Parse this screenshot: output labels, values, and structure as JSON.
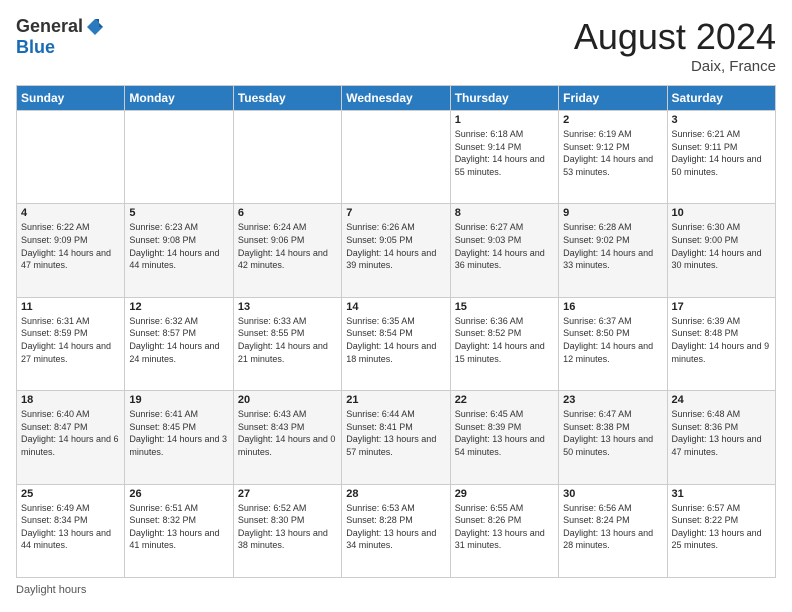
{
  "header": {
    "logo_general": "General",
    "logo_blue": "Blue",
    "month_year": "August 2024",
    "location": "Daix, France"
  },
  "days_of_week": [
    "Sunday",
    "Monday",
    "Tuesday",
    "Wednesday",
    "Thursday",
    "Friday",
    "Saturday"
  ],
  "footer": {
    "daylight_label": "Daylight hours"
  },
  "weeks": [
    [
      {
        "day": "",
        "sunrise": "",
        "sunset": "",
        "daylight": ""
      },
      {
        "day": "",
        "sunrise": "",
        "sunset": "",
        "daylight": ""
      },
      {
        "day": "",
        "sunrise": "",
        "sunset": "",
        "daylight": ""
      },
      {
        "day": "",
        "sunrise": "",
        "sunset": "",
        "daylight": ""
      },
      {
        "day": "1",
        "sunrise": "Sunrise: 6:18 AM",
        "sunset": "Sunset: 9:14 PM",
        "daylight": "Daylight: 14 hours and 55 minutes."
      },
      {
        "day": "2",
        "sunrise": "Sunrise: 6:19 AM",
        "sunset": "Sunset: 9:12 PM",
        "daylight": "Daylight: 14 hours and 53 minutes."
      },
      {
        "day": "3",
        "sunrise": "Sunrise: 6:21 AM",
        "sunset": "Sunset: 9:11 PM",
        "daylight": "Daylight: 14 hours and 50 minutes."
      }
    ],
    [
      {
        "day": "4",
        "sunrise": "Sunrise: 6:22 AM",
        "sunset": "Sunset: 9:09 PM",
        "daylight": "Daylight: 14 hours and 47 minutes."
      },
      {
        "day": "5",
        "sunrise": "Sunrise: 6:23 AM",
        "sunset": "Sunset: 9:08 PM",
        "daylight": "Daylight: 14 hours and 44 minutes."
      },
      {
        "day": "6",
        "sunrise": "Sunrise: 6:24 AM",
        "sunset": "Sunset: 9:06 PM",
        "daylight": "Daylight: 14 hours and 42 minutes."
      },
      {
        "day": "7",
        "sunrise": "Sunrise: 6:26 AM",
        "sunset": "Sunset: 9:05 PM",
        "daylight": "Daylight: 14 hours and 39 minutes."
      },
      {
        "day": "8",
        "sunrise": "Sunrise: 6:27 AM",
        "sunset": "Sunset: 9:03 PM",
        "daylight": "Daylight: 14 hours and 36 minutes."
      },
      {
        "day": "9",
        "sunrise": "Sunrise: 6:28 AM",
        "sunset": "Sunset: 9:02 PM",
        "daylight": "Daylight: 14 hours and 33 minutes."
      },
      {
        "day": "10",
        "sunrise": "Sunrise: 6:30 AM",
        "sunset": "Sunset: 9:00 PM",
        "daylight": "Daylight: 14 hours and 30 minutes."
      }
    ],
    [
      {
        "day": "11",
        "sunrise": "Sunrise: 6:31 AM",
        "sunset": "Sunset: 8:59 PM",
        "daylight": "Daylight: 14 hours and 27 minutes."
      },
      {
        "day": "12",
        "sunrise": "Sunrise: 6:32 AM",
        "sunset": "Sunset: 8:57 PM",
        "daylight": "Daylight: 14 hours and 24 minutes."
      },
      {
        "day": "13",
        "sunrise": "Sunrise: 6:33 AM",
        "sunset": "Sunset: 8:55 PM",
        "daylight": "Daylight: 14 hours and 21 minutes."
      },
      {
        "day": "14",
        "sunrise": "Sunrise: 6:35 AM",
        "sunset": "Sunset: 8:54 PM",
        "daylight": "Daylight: 14 hours and 18 minutes."
      },
      {
        "day": "15",
        "sunrise": "Sunrise: 6:36 AM",
        "sunset": "Sunset: 8:52 PM",
        "daylight": "Daylight: 14 hours and 15 minutes."
      },
      {
        "day": "16",
        "sunrise": "Sunrise: 6:37 AM",
        "sunset": "Sunset: 8:50 PM",
        "daylight": "Daylight: 14 hours and 12 minutes."
      },
      {
        "day": "17",
        "sunrise": "Sunrise: 6:39 AM",
        "sunset": "Sunset: 8:48 PM",
        "daylight": "Daylight: 14 hours and 9 minutes."
      }
    ],
    [
      {
        "day": "18",
        "sunrise": "Sunrise: 6:40 AM",
        "sunset": "Sunset: 8:47 PM",
        "daylight": "Daylight: 14 hours and 6 minutes."
      },
      {
        "day": "19",
        "sunrise": "Sunrise: 6:41 AM",
        "sunset": "Sunset: 8:45 PM",
        "daylight": "Daylight: 14 hours and 3 minutes."
      },
      {
        "day": "20",
        "sunrise": "Sunrise: 6:43 AM",
        "sunset": "Sunset: 8:43 PM",
        "daylight": "Daylight: 14 hours and 0 minutes."
      },
      {
        "day": "21",
        "sunrise": "Sunrise: 6:44 AM",
        "sunset": "Sunset: 8:41 PM",
        "daylight": "Daylight: 13 hours and 57 minutes."
      },
      {
        "day": "22",
        "sunrise": "Sunrise: 6:45 AM",
        "sunset": "Sunset: 8:39 PM",
        "daylight": "Daylight: 13 hours and 54 minutes."
      },
      {
        "day": "23",
        "sunrise": "Sunrise: 6:47 AM",
        "sunset": "Sunset: 8:38 PM",
        "daylight": "Daylight: 13 hours and 50 minutes."
      },
      {
        "day": "24",
        "sunrise": "Sunrise: 6:48 AM",
        "sunset": "Sunset: 8:36 PM",
        "daylight": "Daylight: 13 hours and 47 minutes."
      }
    ],
    [
      {
        "day": "25",
        "sunrise": "Sunrise: 6:49 AM",
        "sunset": "Sunset: 8:34 PM",
        "daylight": "Daylight: 13 hours and 44 minutes."
      },
      {
        "day": "26",
        "sunrise": "Sunrise: 6:51 AM",
        "sunset": "Sunset: 8:32 PM",
        "daylight": "Daylight: 13 hours and 41 minutes."
      },
      {
        "day": "27",
        "sunrise": "Sunrise: 6:52 AM",
        "sunset": "Sunset: 8:30 PM",
        "daylight": "Daylight: 13 hours and 38 minutes."
      },
      {
        "day": "28",
        "sunrise": "Sunrise: 6:53 AM",
        "sunset": "Sunset: 8:28 PM",
        "daylight": "Daylight: 13 hours and 34 minutes."
      },
      {
        "day": "29",
        "sunrise": "Sunrise: 6:55 AM",
        "sunset": "Sunset: 8:26 PM",
        "daylight": "Daylight: 13 hours and 31 minutes."
      },
      {
        "day": "30",
        "sunrise": "Sunrise: 6:56 AM",
        "sunset": "Sunset: 8:24 PM",
        "daylight": "Daylight: 13 hours and 28 minutes."
      },
      {
        "day": "31",
        "sunrise": "Sunrise: 6:57 AM",
        "sunset": "Sunset: 8:22 PM",
        "daylight": "Daylight: 13 hours and 25 minutes."
      }
    ]
  ]
}
